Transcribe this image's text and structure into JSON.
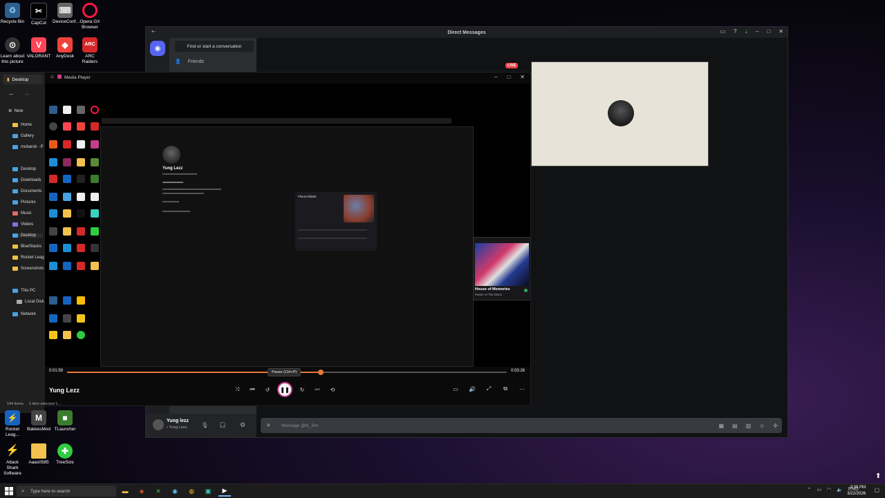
{
  "desktop_icons": [
    {
      "label": "Recycle Bin",
      "icon": "recycle-bin-icon",
      "color": "#7ab7e8"
    },
    {
      "label": "CapCut",
      "icon": "capcut-icon",
      "color": "#ffffff"
    },
    {
      "label": "DeviceConf...",
      "icon": "device-config-icon",
      "color": "#888888"
    },
    {
      "label": "Opera GX Browser",
      "icon": "opera-gx-icon",
      "color": "#ff1744"
    },
    {
      "label": "Learn about this picture",
      "icon": "learn-picture-icon",
      "color": "#ffffff"
    },
    {
      "label": "VALORANT",
      "icon": "valorant-icon",
      "color": "#fd4556"
    },
    {
      "label": "AnyDesk",
      "icon": "anydesk-icon",
      "color": "#ef443b"
    },
    {
      "label": "ARC Raiders",
      "icon": "arc-raiders-icon",
      "color": "#d62828"
    },
    {
      "label": "Rocket Leag...",
      "icon": "rocket-league-icon",
      "color": "#1565c0"
    },
    {
      "label": "BakkesMod",
      "icon": "bakkesmod-icon",
      "color": "#444444"
    },
    {
      "label": "TLauncher",
      "icon": "tlauncher-icon",
      "color": "#3a7d2e"
    },
    {
      "label": "Attack Shark Software",
      "icon": "attack-shark-icon",
      "color": "#f5c518"
    },
    {
      "label": "Aaas0585",
      "icon": "folder-icon",
      "color": "#f2c14e"
    },
    {
      "label": "TreeSize",
      "icon": "treesize-icon",
      "color": "#2ecc40"
    }
  ],
  "discord": {
    "window_title": "Direct Messages",
    "find_button": "Find or start a conversation",
    "friends_label": "Friends",
    "live_badge": "LIVE",
    "user_name": "Yung lezz",
    "user_status": "• Yung Lezz,",
    "message_placeholder": "Message @lil_Jim"
  },
  "explorer": {
    "title": "Desktop",
    "new_label": "New",
    "items": [
      {
        "label": "Home",
        "color": "#f0c040"
      },
      {
        "label": "Gallery",
        "color": "#4aa3df"
      },
      {
        "label": "mubarok - P",
        "color": "#4aa3df"
      },
      {
        "label": "Desktop",
        "color": "#4aa3df"
      },
      {
        "label": "Downloads",
        "color": "#4aa3df"
      },
      {
        "label": "Documents",
        "color": "#4aa3df"
      },
      {
        "label": "Pictures",
        "color": "#4aa3df"
      },
      {
        "label": "Music",
        "color": "#e06b6b"
      },
      {
        "label": "Videos",
        "color": "#8e6be0"
      },
      {
        "label": "Desktop",
        "color": "#4aa3df"
      },
      {
        "label": "BlueStacks",
        "color": "#f0c040"
      },
      {
        "label": "Rocket Leag",
        "color": "#f0c040"
      },
      {
        "label": "Screenshots",
        "color": "#f0c040"
      },
      {
        "label": "This PC",
        "color": "#4aa3df"
      },
      {
        "label": "Local Disk",
        "color": "#aaaaaa"
      },
      {
        "label": "Network",
        "color": "#4aa3df"
      }
    ],
    "count_label": "144 items",
    "selected_label": "1 item selected 1..."
  },
  "media_player": {
    "title": "Media Player",
    "track_title": "Yung Lezz",
    "time_current": "0:01:59",
    "time_total": "0:03:26",
    "progress_fraction": 0.577,
    "tooltip": "Pause (Ctrl+P)",
    "accent": "#e8773a",
    "inner": {
      "profile_name": "Yung Lezz",
      "widget_title": "Placed Blade",
      "house_title": "House of Memories",
      "house_sub": "Panic! At The Disco"
    }
  },
  "taskbar": {
    "search_placeholder": "Type here to search",
    "time": "3:39 PM",
    "date": "3/22/2026",
    "apps": [
      {
        "icon": "file-explorer-icon",
        "glyph": "🗀",
        "color": "#f2c14e"
      },
      {
        "icon": "brave-icon",
        "glyph": "◈",
        "color": "#fb542b"
      },
      {
        "icon": "xbox-icon",
        "glyph": "✕",
        "color": "#3fbf4a"
      },
      {
        "icon": "steam-icon",
        "glyph": "◉",
        "color": "#66c0f4"
      },
      {
        "icon": "chrome-icon",
        "glyph": "◍",
        "color": "#fbbc05"
      },
      {
        "icon": "capture-icon",
        "glyph": "▣",
        "color": "#3bd1c0"
      },
      {
        "icon": "media-player-icon",
        "glyph": "▶",
        "color": "#ffffff"
      }
    ]
  }
}
